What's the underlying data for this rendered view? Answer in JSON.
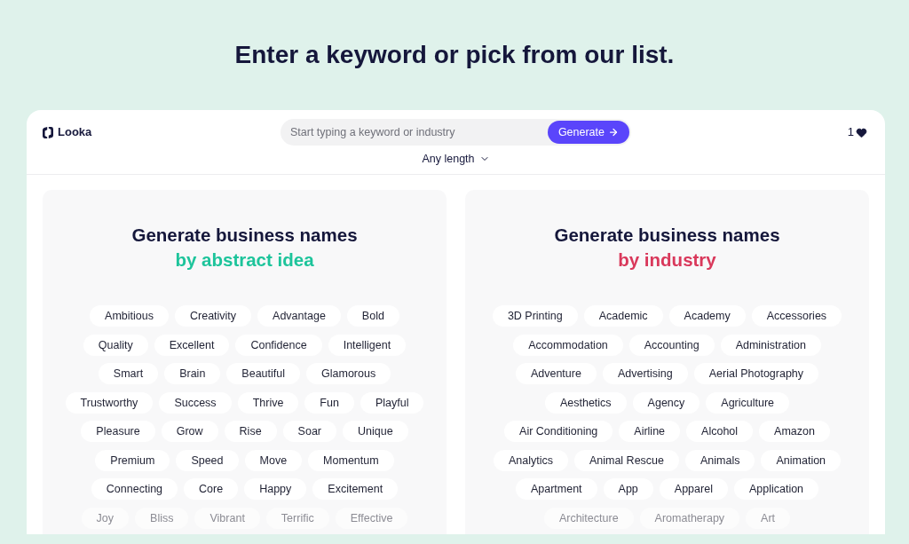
{
  "heading": "Enter a keyword or pick from our list.",
  "header": {
    "brand": "Looka",
    "search": {
      "placeholder": "Start typing a keyword or industry"
    },
    "generate_button": "Generate",
    "favorites_count": "1",
    "length_dropdown": "Any length"
  },
  "panels": [
    {
      "title": "Generate business names",
      "subtitle": "by abstract idea",
      "color": "#1dc49b",
      "rows": [
        {
          "tags": [
            "Ambitious",
            "Creativity",
            "Advantage",
            "Bold"
          ],
          "faded": false
        },
        {
          "tags": [
            "Quality",
            "Excellent",
            "Confidence",
            "Intelligent"
          ],
          "faded": false
        },
        {
          "tags": [
            "Smart",
            "Brain",
            "Beautiful",
            "Glamorous"
          ],
          "faded": false
        },
        {
          "tags": [
            "Trustworthy",
            "Success",
            "Thrive",
            "Fun",
            "Playful"
          ],
          "faded": false
        },
        {
          "tags": [
            "Pleasure",
            "Grow",
            "Rise",
            "Soar",
            "Unique"
          ],
          "faded": false
        },
        {
          "tags": [
            "Premium",
            "Speed",
            "Move",
            "Momentum"
          ],
          "faded": false
        },
        {
          "tags": [
            "Connecting",
            "Core",
            "Happy",
            "Excitement"
          ],
          "faded": false
        },
        {
          "tags": [
            "Joy",
            "Bliss",
            "Vibrant",
            "Terrific",
            "Effective"
          ],
          "faded": true
        }
      ]
    },
    {
      "title": "Generate business names",
      "subtitle": "by industry",
      "color": "#d9385b",
      "rows": [
        {
          "tags": [
            "3D Printing",
            "Academic",
            "Academy",
            "Accessories"
          ],
          "faded": false
        },
        {
          "tags": [
            "Accommodation",
            "Accounting",
            "Administration"
          ],
          "faded": false
        },
        {
          "tags": [
            "Adventure",
            "Advertising",
            "Aerial Photography"
          ],
          "faded": false
        },
        {
          "tags": [
            "Aesthetics",
            "Agency",
            "Agriculture"
          ],
          "faded": false
        },
        {
          "tags": [
            "Air Conditioning",
            "Airline",
            "Alcohol",
            "Amazon"
          ],
          "faded": false
        },
        {
          "tags": [
            "Analytics",
            "Animal Rescue",
            "Animals",
            "Animation"
          ],
          "faded": false
        },
        {
          "tags": [
            "Apartment",
            "App",
            "Apparel",
            "Application"
          ],
          "faded": false
        },
        {
          "tags": [
            "Architecture",
            "Aromatherapy",
            "Art"
          ],
          "faded": true
        }
      ]
    }
  ]
}
